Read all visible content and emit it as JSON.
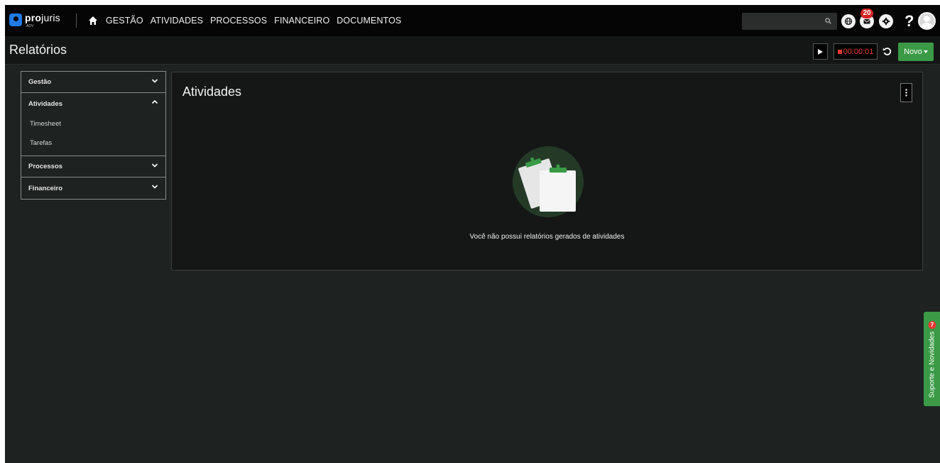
{
  "app": {
    "logo_bold": "pro",
    "logo_rest": "juris",
    "logo_sub": "ADV"
  },
  "nav": {
    "items": [
      {
        "label": "GESTÃO"
      },
      {
        "label": "ATIVIDADES"
      },
      {
        "label": "PROCESSOS"
      },
      {
        "label": "FINANCEIRO"
      },
      {
        "label": "DOCUMENTOS"
      }
    ],
    "search_placeholder": "",
    "messages_badge": "20"
  },
  "pagebar": {
    "title": "Relatórios",
    "timer": "00:00:01",
    "novo_label": "Novo"
  },
  "sidebar": {
    "sections": [
      {
        "label": "Gestão"
      },
      {
        "label": "Atividades",
        "items": [
          {
            "label": "Timesheet"
          },
          {
            "label": "Tarefas"
          }
        ]
      },
      {
        "label": "Processos"
      },
      {
        "label": "Financeiro"
      }
    ]
  },
  "main": {
    "title": "Atividades",
    "empty_message": "Você não possui relatórios gerados de atividades"
  },
  "support_tab": {
    "label": "Suporte e Novidades",
    "badge": "7"
  },
  "colors": {
    "accent_green": "#3a9a45",
    "badge_red": "#d32424",
    "brand_blue": "#1f7ae8",
    "timer_red": "#e53935"
  },
  "icons": [
    "home-icon",
    "search-icon",
    "globe-icon",
    "mail-icon",
    "gear-icon",
    "help-icon",
    "play-icon",
    "stop-icon",
    "reset-icon",
    "chevron-down-icon",
    "chevron-up-icon",
    "kebab-icon",
    "clipboard-icon"
  ]
}
